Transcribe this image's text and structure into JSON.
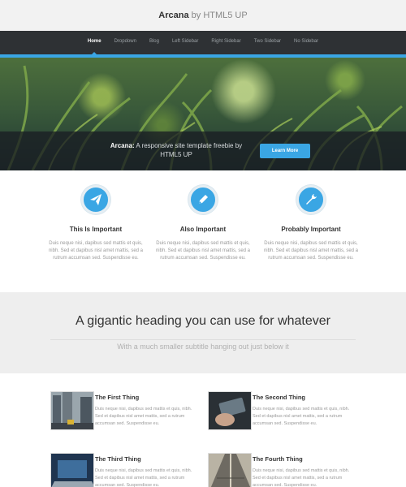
{
  "header": {
    "brand": "Arcana",
    "by": "by HTML5 UP"
  },
  "nav": {
    "items": [
      "Home",
      "Dropdown",
      "Blog",
      "Left Sidebar",
      "Right Sidebar",
      "Two Sidebar",
      "No Sidebar"
    ],
    "active": "Home"
  },
  "banner": {
    "brand": "Arcana:",
    "text": "A responsive site template freebie by HTML5 UP",
    "button": "Learn More"
  },
  "features": [
    {
      "title": "This Is Important",
      "text": "Duis neque nisi, dapibus sed mattis et quis, nibh. Sed et dapibus nisl amet mattis, sed a rutrum accumsan sed. Suspendisse eu.",
      "icon": "paper-plane-icon"
    },
    {
      "title": "Also Important",
      "text": "Duis neque nisi, dapibus sed mattis et quis, nibh. Sed et dapibus nisl amet mattis, sed a rutrum accumsan sed. Suspendisse eu.",
      "icon": "pencil-icon"
    },
    {
      "title": "Probably Important",
      "text": "Duis neque nisi, dapibus sed mattis et quis, nibh. Sed et dapibus nisl amet mattis, sed a rutrum accumsan sed. Suspendisse eu.",
      "icon": "wrench-icon"
    }
  ],
  "headline": {
    "title": "A gigantic heading you can use for whatever",
    "subtitle": "With a much smaller subtitle hanging out just below it"
  },
  "things": [
    {
      "title": "The First Thing",
      "text": "Duis neque nisi, dapibus sed mattis et quis, nibh. Sed et dapibus nisl amet mattis, sed a rutrum accumsan sed. Suspendisse eu."
    },
    {
      "title": "The Second Thing",
      "text": "Duis neque nisi, dapibus sed mattis et quis, nibh. Sed et dapibus nisl amet mattis, sed a rutrum accumsan sed. Suspendisse eu."
    },
    {
      "title": "The Third Thing",
      "text": "Duis neque nisi, dapibus sed mattis et quis, nibh. Sed et dapibus nisl amet mattis, sed a rutrum accumsan sed. Suspendisse eu."
    },
    {
      "title": "The Fourth Thing",
      "text": "Duis neque nisi, dapibus sed mattis et quis, nibh. Sed et dapibus nisl amet mattis, sed a rutrum accumsan sed. Suspendisse eu."
    }
  ],
  "colors": {
    "accent": "#3aa6e4",
    "nav_bg": "#2e3134"
  }
}
